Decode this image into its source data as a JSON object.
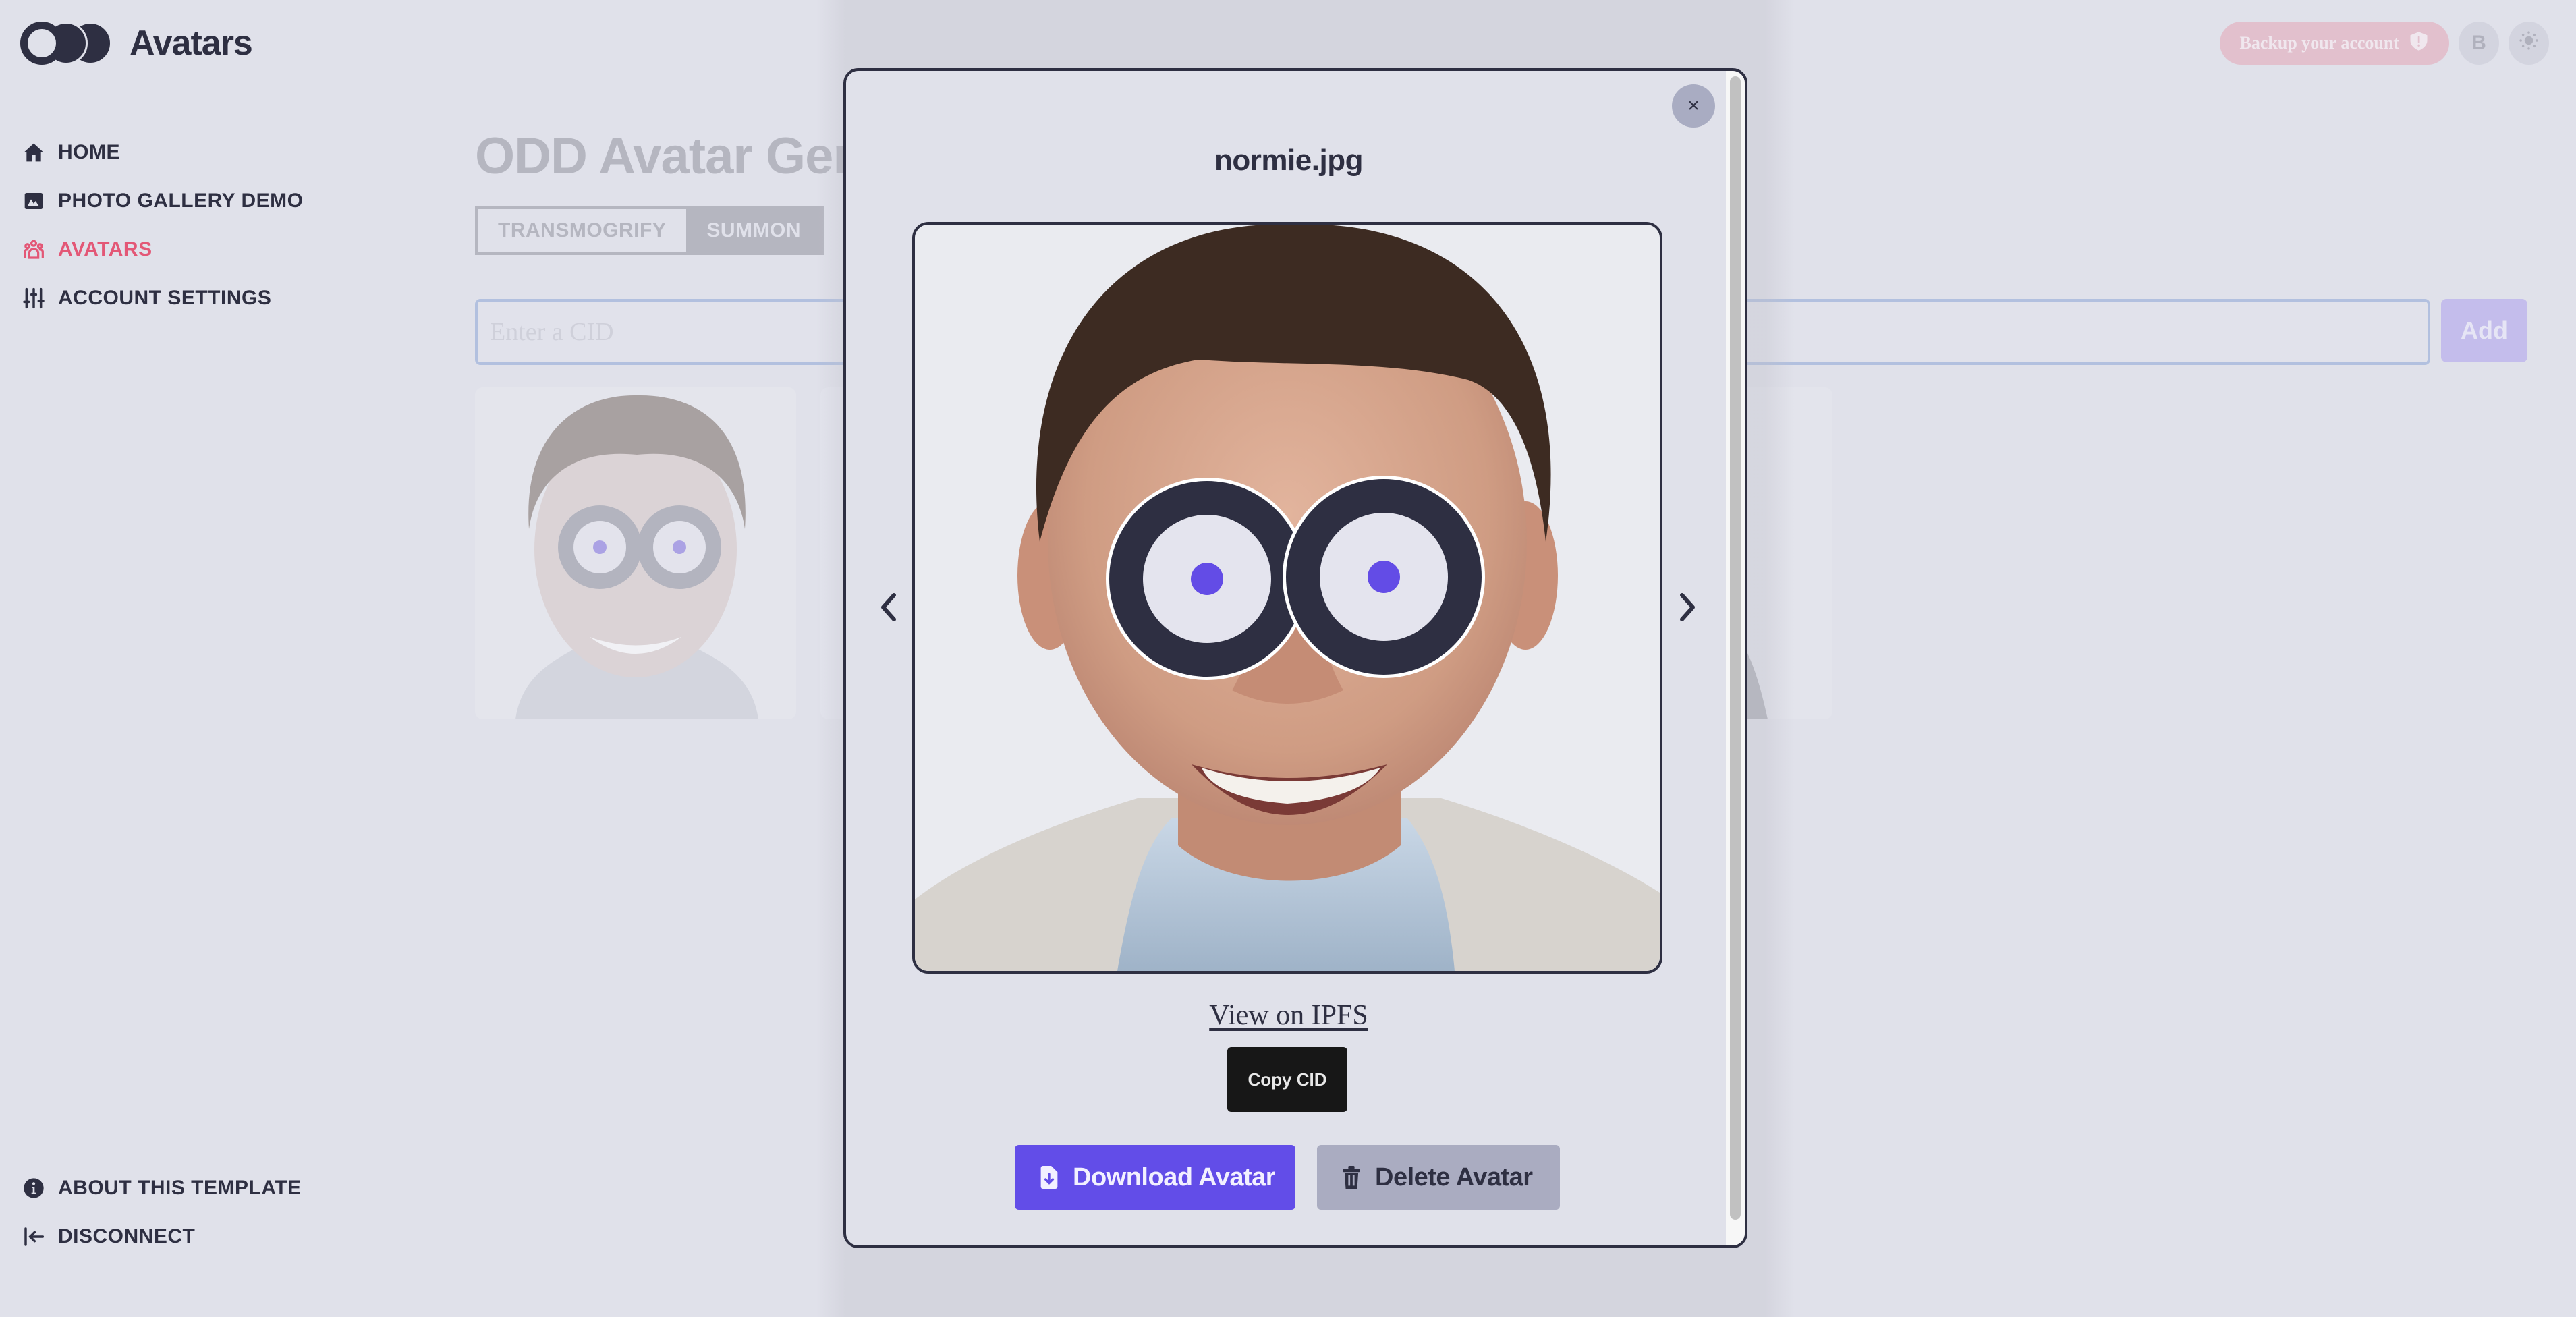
{
  "app": {
    "title": "Avatars"
  },
  "sidebar": {
    "items": [
      {
        "label": "HOME",
        "icon": "home-icon",
        "active": false
      },
      {
        "label": "PHOTO GALLERY DEMO",
        "icon": "image-icon",
        "active": false
      },
      {
        "label": "AVATARS",
        "icon": "users-icon",
        "active": true
      },
      {
        "label": "ACCOUNT SETTINGS",
        "icon": "sliders-icon",
        "active": false
      }
    ],
    "bottom_items": [
      {
        "label": "ABOUT THIS TEMPLATE",
        "icon": "info-icon"
      },
      {
        "label": "DISCONNECT",
        "icon": "logout-icon"
      }
    ]
  },
  "topbar": {
    "backup_label": "Backup your account",
    "backup_icon": "shield-alert-icon",
    "user_initial": "B",
    "theme_icon": "sun-icon"
  },
  "main": {
    "page_title": "ODD Avatar Generator",
    "tabs": [
      {
        "label": "TRANSMOGRIFY",
        "active": false
      },
      {
        "label": "SUMMON",
        "active": true
      }
    ],
    "cid_input": {
      "value": "",
      "placeholder": "Enter a CID"
    },
    "add_label": "Add"
  },
  "modal": {
    "title": "normie.jpg",
    "close_label": "×",
    "ipfs_link": "View on IPFS",
    "copy_cid_label": "Copy CID",
    "download_label": "Download Avatar",
    "delete_label": "Delete Avatar",
    "colors": {
      "accent": "#624de8",
      "pupil": "#634ce6",
      "ring": "#2e2f42"
    }
  }
}
